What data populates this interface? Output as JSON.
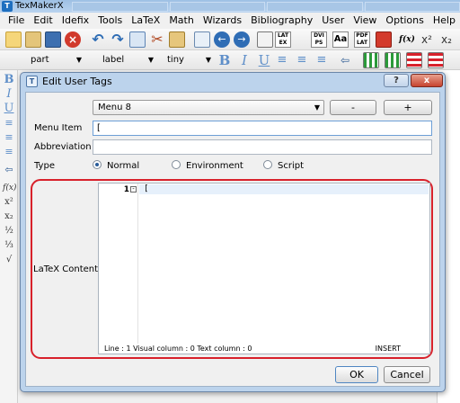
{
  "app": {
    "title": "TexMakerX"
  },
  "menubar": [
    "File",
    "Edit",
    "Idefix",
    "Tools",
    "LaTeX",
    "Math",
    "Wizards",
    "Bibliography",
    "User",
    "View",
    "Options",
    "Help"
  ],
  "toolbar_text_icons": [
    "LAT EX",
    "DVI PS",
    "Aa",
    "PDF LAT",
    "f(x)"
  ],
  "format_bar": {
    "sectioning": "part",
    "references": "label",
    "size": "tiny"
  },
  "dialog": {
    "title": "Edit User Tags",
    "help_label": "?",
    "close_label": "x",
    "menu_select": "Menu 8",
    "minus_label": "-",
    "plus_label": "+",
    "menu_item_label": "Menu Item",
    "menu_item_value": "[",
    "abbreviation_label": "Abbreviation",
    "abbreviation_value": "",
    "type_label": "Type",
    "type_options": [
      {
        "label": "Normal",
        "selected": true
      },
      {
        "label": "Environment",
        "selected": false
      },
      {
        "label": "Script",
        "selected": false
      }
    ],
    "content_label": "LaTeX Content",
    "editor": {
      "line_number": "1",
      "code": "[",
      "status_position": "Line : 1 Visual column : 0 Text column : 0",
      "status_mode": "INSERT"
    },
    "ok_label": "OK",
    "cancel_label": "Cancel"
  },
  "colors": {
    "highlight_outline": "#d8212b",
    "dialog_frame": "#bcd3ec",
    "accent": "#5f8fc9"
  }
}
